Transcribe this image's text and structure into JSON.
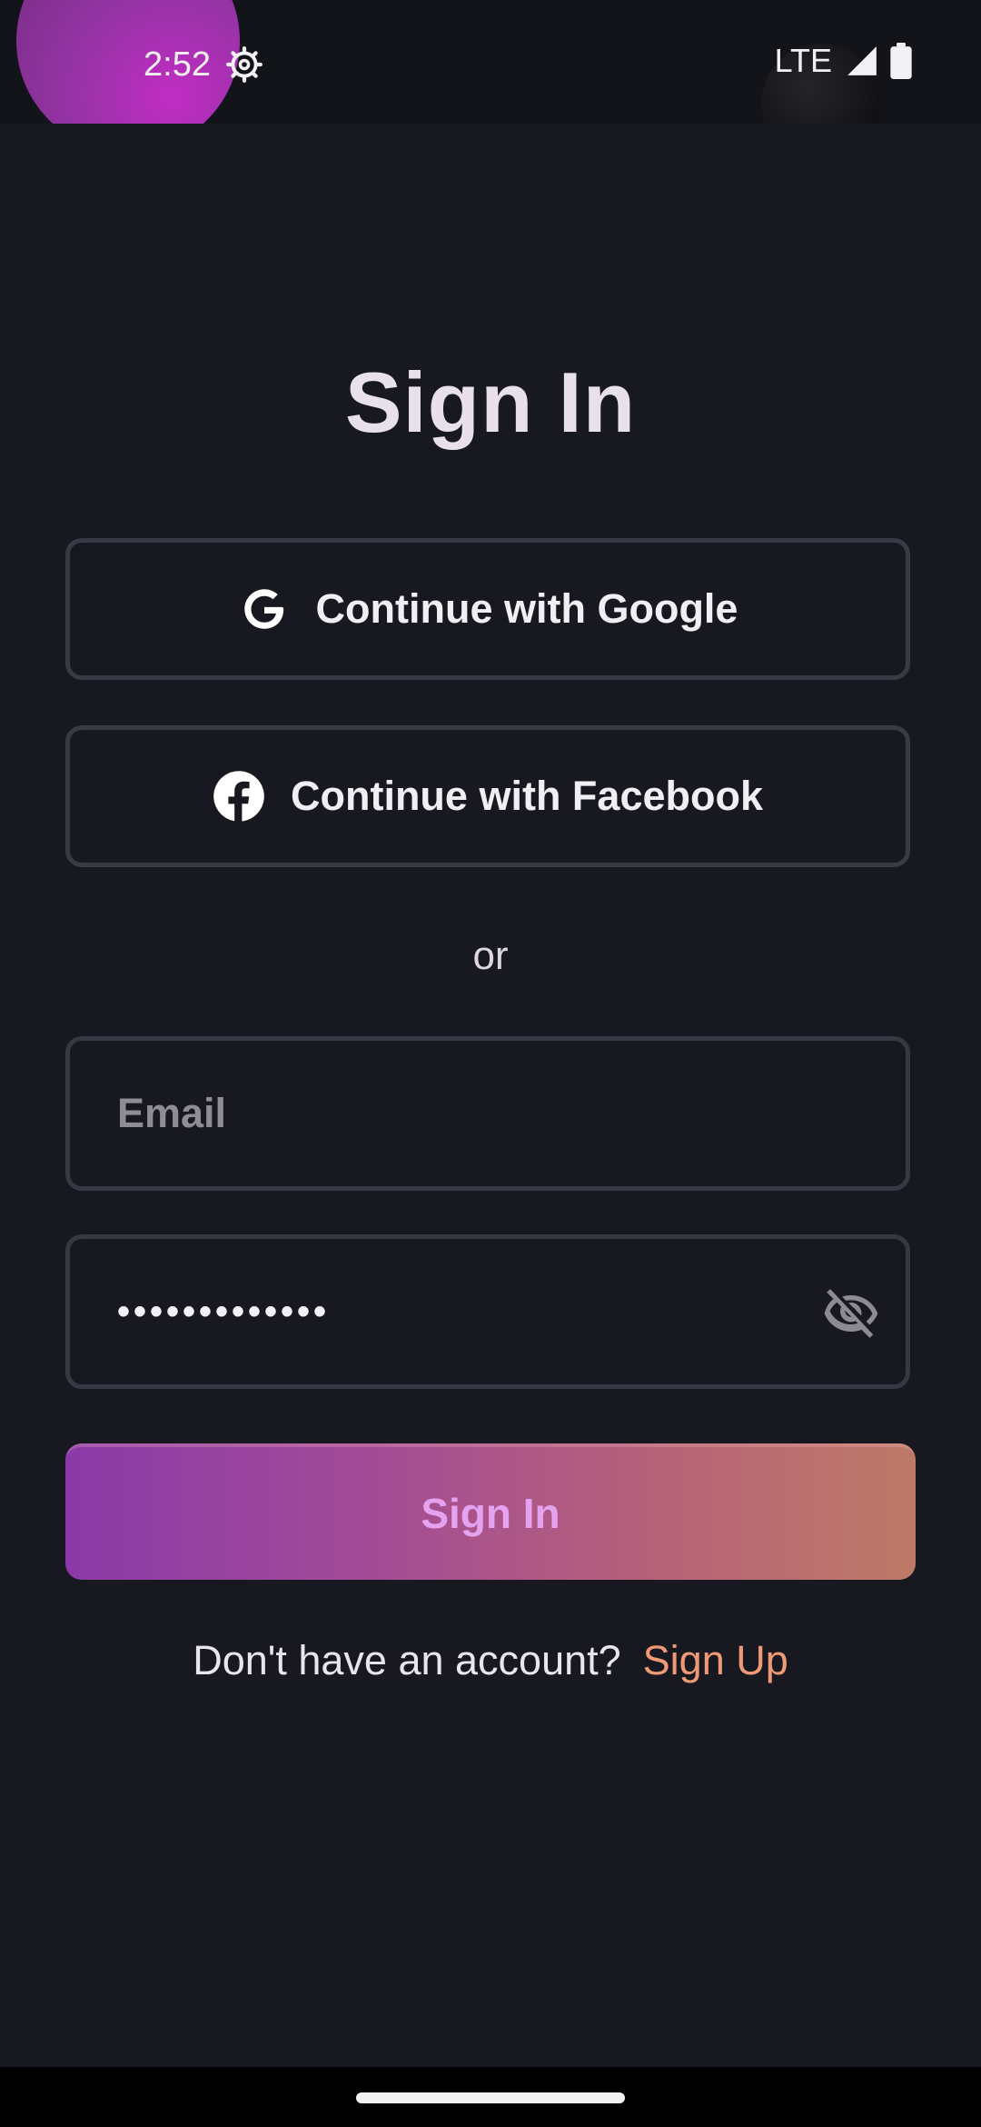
{
  "status_bar": {
    "time": "2:52",
    "network": "LTE",
    "icons": [
      "gear-icon",
      "signal-icon",
      "battery-icon"
    ]
  },
  "title": "Sign In",
  "buttons": {
    "google": "Continue with Google",
    "facebook": "Continue with Facebook",
    "sign_in": "Sign In"
  },
  "divider": "or",
  "fields": {
    "email_placeholder": "Email",
    "email_value": "",
    "password_value": "•••••••••••••",
    "password_toggle_icon": "eye-off-icon"
  },
  "footer": {
    "prompt": "Don't have an account?",
    "link": "Sign Up"
  },
  "colors": {
    "background": "#181920",
    "accent": "#ef9a76",
    "button_gradient_start": "#8a3aa8",
    "button_gradient_end": "#bd7a67"
  }
}
